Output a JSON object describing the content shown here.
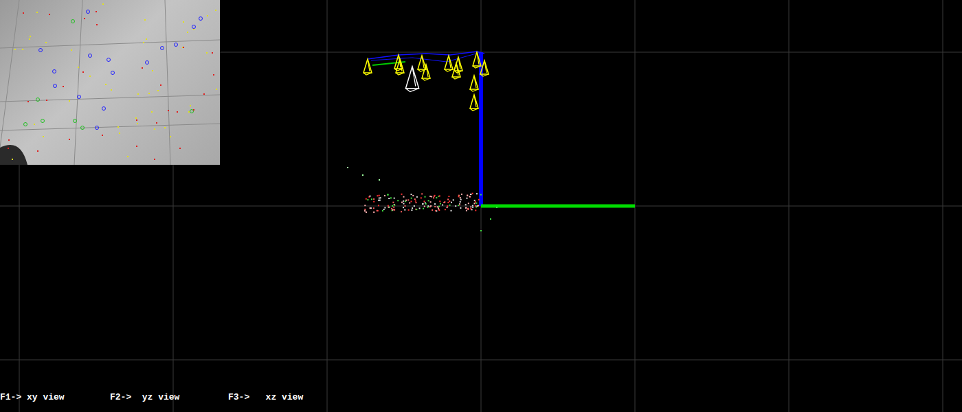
{
  "view_hints": [
    {
      "text": "F1-> xy view"
    },
    {
      "text": "F2->  yz view"
    },
    {
      "text": "F3->   xz view"
    }
  ]
}
